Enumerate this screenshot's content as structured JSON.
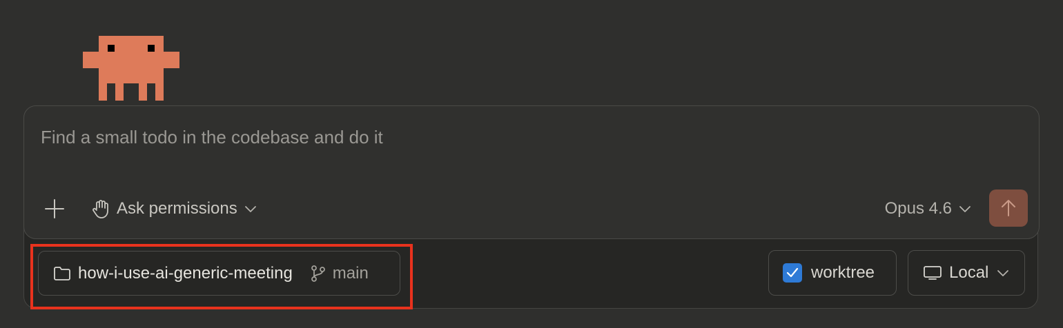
{
  "composer": {
    "placeholder": "Find a small todo in the codebase and do it",
    "add_icon": "plus-icon",
    "permissions": {
      "icon": "hand-icon",
      "label": "Ask permissions"
    },
    "model": {
      "label": "Opus 4.6"
    },
    "send_icon": "arrow-up-icon"
  },
  "bottom_bar": {
    "repo": {
      "icon": "folder-icon",
      "name": "how-i-use-ai-generic-meeting",
      "branch_icon": "git-branch-icon",
      "branch": "main"
    },
    "worktree": {
      "label": "worktree",
      "checked": true
    },
    "environment": {
      "icon": "monitor-icon",
      "label": "Local"
    }
  },
  "colors": {
    "background": "#2f2f2d",
    "mascot": "#de7b5a",
    "send_button": "#7e4e3f",
    "checkbox": "#2e7ad6",
    "highlight": "#e8321d"
  }
}
